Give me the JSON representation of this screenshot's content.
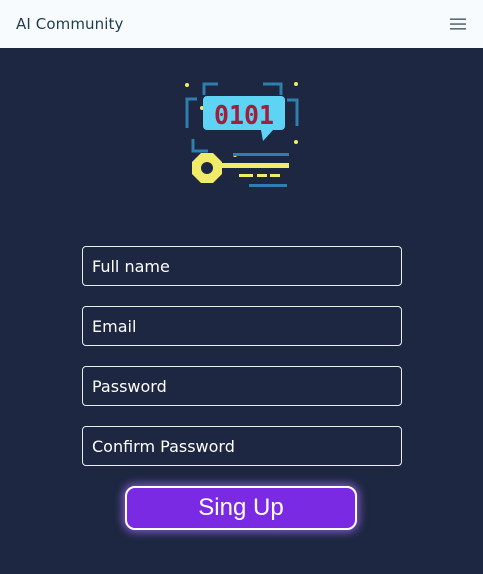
{
  "navbar": {
    "brand": "AI Community",
    "menu_icon": "hamburger-menu-icon"
  },
  "hero": {
    "icon": "binary-key-chat-icon",
    "binary_text": "0101",
    "colors": {
      "bubble": "#5fd3f3",
      "digits": "#a31d3d",
      "key": "#f0ec6a",
      "circuit": "#2e7eae"
    }
  },
  "form": {
    "full_name_placeholder": "Full name",
    "email_placeholder": "Email",
    "password_placeholder": "Password",
    "confirm_password_placeholder": "Confirm Password",
    "submit_label": "Sing Up"
  },
  "colors": {
    "page_background": "#1d2741",
    "navbar_background": "#f7fbfd",
    "brand_text": "#1f3b4d",
    "button": "#7b2ae4"
  }
}
